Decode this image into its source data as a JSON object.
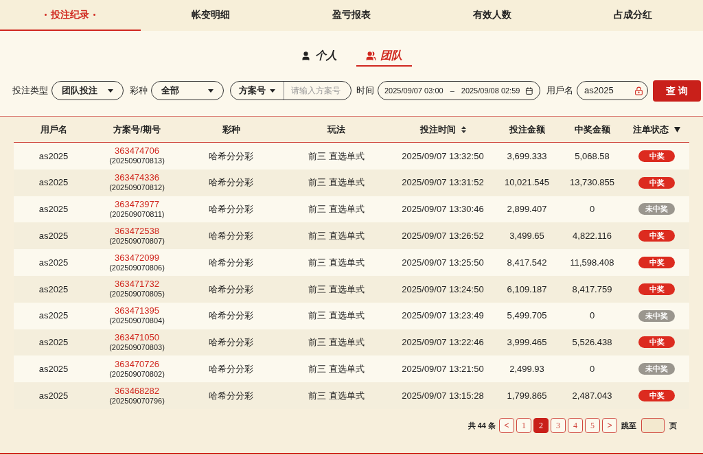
{
  "tabs": [
    {
      "label": "投注纪录",
      "selected": true
    },
    {
      "label": "帐变明细",
      "selected": false
    },
    {
      "label": "盈亏报表",
      "selected": false
    },
    {
      "label": "有效人数",
      "selected": false
    },
    {
      "label": "占成分红",
      "selected": false
    }
  ],
  "scope_tabs": [
    {
      "label": "个人",
      "kind": "person",
      "selected": false
    },
    {
      "label": "团队",
      "kind": "group",
      "selected": true
    }
  ],
  "filters": {
    "bet_type": {
      "label": "投注类型",
      "value": "团队投注"
    },
    "lottery": {
      "label": "彩种",
      "value": "全部"
    },
    "plan": {
      "select": "方案号",
      "placeholder": "请输入方案号"
    },
    "time": {
      "label": "时间",
      "start": "2025/09/07 03:00",
      "separator": "–",
      "end": "2025/09/08 02:59"
    },
    "username": {
      "label": "用戶名",
      "value": "as2025"
    },
    "query_button": "查 询"
  },
  "table": {
    "columns": [
      {
        "label": "用戶名"
      },
      {
        "label": "方案号/期号"
      },
      {
        "label": "彩种"
      },
      {
        "label": "玩法"
      },
      {
        "label": "投注时间",
        "kind": "sort"
      },
      {
        "label": "投注金额"
      },
      {
        "label": "中奖金额"
      },
      {
        "label": "注单状态",
        "kind": "filter"
      }
    ],
    "rows": [
      {
        "user": "as2025",
        "plan": "363474706",
        "issue": "(202509070813)",
        "lottery": "哈希分分彩",
        "play": "前三 直选单式",
        "time": "2025/09/07 13:32:50",
        "bet": "3,699.333",
        "win": "5,068.58",
        "status": {
          "label": "中奖",
          "kind": "won"
        }
      },
      {
        "user": "as2025",
        "plan": "363474336",
        "issue": "(202509070812)",
        "lottery": "哈希分分彩",
        "play": "前三 直选单式",
        "time": "2025/09/07 13:31:52",
        "bet": "10,021.545",
        "win": "13,730.855",
        "status": {
          "label": "中奖",
          "kind": "won"
        }
      },
      {
        "user": "as2025",
        "plan": "363473977",
        "issue": "(202509070811)",
        "lottery": "哈希分分彩",
        "play": "前三 直选单式",
        "time": "2025/09/07 13:30:46",
        "bet": "2,899.407",
        "win": "0",
        "status": {
          "label": "未中奖",
          "kind": "lost"
        }
      },
      {
        "user": "as2025",
        "plan": "363472538",
        "issue": "(202509070807)",
        "lottery": "哈希分分彩",
        "play": "前三 直选单式",
        "time": "2025/09/07 13:26:52",
        "bet": "3,499.65",
        "win": "4,822.116",
        "status": {
          "label": "中奖",
          "kind": "won"
        }
      },
      {
        "user": "as2025",
        "plan": "363472099",
        "issue": "(202509070806)",
        "lottery": "哈希分分彩",
        "play": "前三 直选单式",
        "time": "2025/09/07 13:25:50",
        "bet": "8,417.542",
        "win": "11,598.408",
        "status": {
          "label": "中奖",
          "kind": "won"
        }
      },
      {
        "user": "as2025",
        "plan": "363471732",
        "issue": "(202509070805)",
        "lottery": "哈希分分彩",
        "play": "前三 直选单式",
        "time": "2025/09/07 13:24:50",
        "bet": "6,109.187",
        "win": "8,417.759",
        "status": {
          "label": "中奖",
          "kind": "won"
        }
      },
      {
        "user": "as2025",
        "plan": "363471395",
        "issue": "(202509070804)",
        "lottery": "哈希分分彩",
        "play": "前三 直选单式",
        "time": "2025/09/07 13:23:49",
        "bet": "5,499.705",
        "win": "0",
        "status": {
          "label": "未中奖",
          "kind": "lost"
        }
      },
      {
        "user": "as2025",
        "plan": "363471050",
        "issue": "(202509070803)",
        "lottery": "哈希分分彩",
        "play": "前三 直选单式",
        "time": "2025/09/07 13:22:46",
        "bet": "3,999.465",
        "win": "5,526.438",
        "status": {
          "label": "中奖",
          "kind": "won"
        }
      },
      {
        "user": "as2025",
        "plan": "363470726",
        "issue": "(202509070802)",
        "lottery": "哈希分分彩",
        "play": "前三 直选单式",
        "time": "2025/09/07 13:21:50",
        "bet": "2,499.93",
        "win": "0",
        "status": {
          "label": "未中奖",
          "kind": "lost"
        }
      },
      {
        "user": "as2025",
        "plan": "363468282",
        "issue": "(202509070796)",
        "lottery": "哈希分分彩",
        "play": "前三 直选单式",
        "time": "2025/09/07 13:15:28",
        "bet": "1,799.865",
        "win": "2,487.043",
        "status": {
          "label": "中奖",
          "kind": "won"
        }
      }
    ]
  },
  "pagination": {
    "total": "共 44 条",
    "prev": "<",
    "pages": [
      {
        "label": "1",
        "selected": false
      },
      {
        "label": "2",
        "selected": true
      },
      {
        "label": "3",
        "selected": false
      },
      {
        "label": "4",
        "selected": false
      },
      {
        "label": "5",
        "selected": false
      }
    ],
    "next": ">",
    "jump_label": "跳至",
    "page_suffix": "页"
  }
}
